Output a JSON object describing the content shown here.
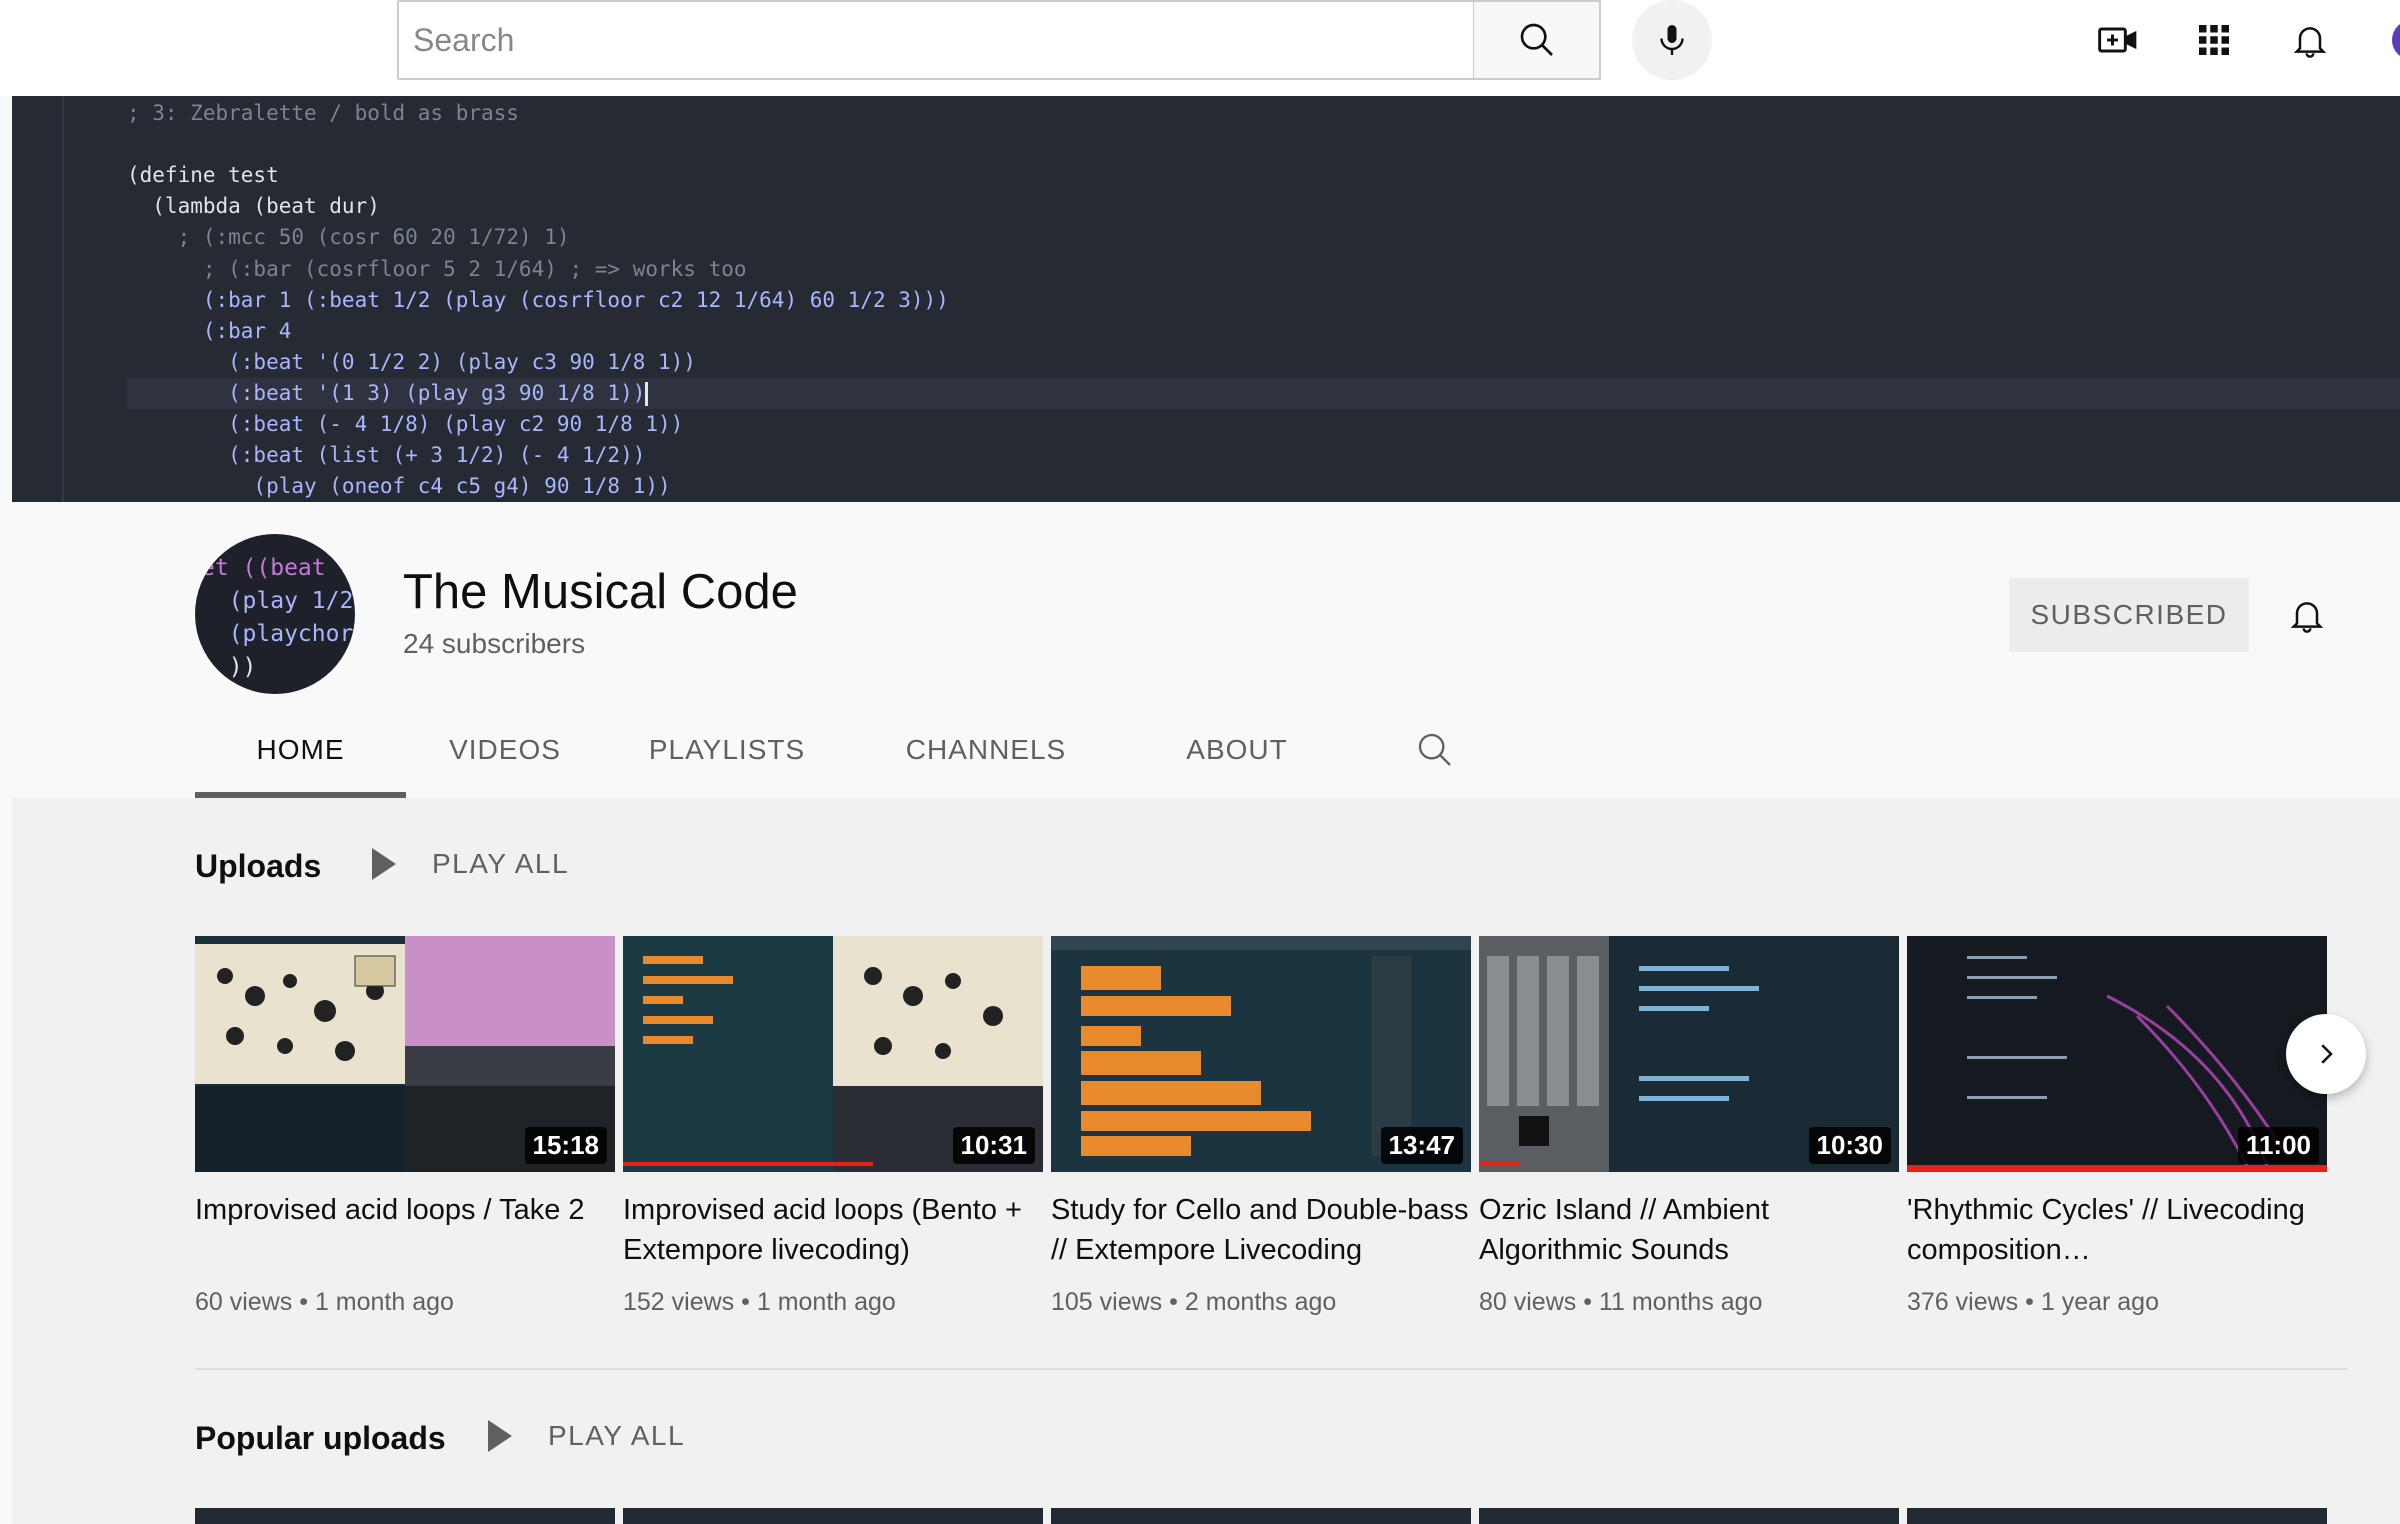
{
  "topbar": {
    "search_placeholder": "Search",
    "icons": [
      "search-icon",
      "mic-icon",
      "create-video-icon",
      "apps-grid-icon",
      "notifications-bell-icon",
      "account-avatar"
    ]
  },
  "banner": {
    "code_lines": [
      "; 3: Zebralette / bold as brass",
      "",
      "(define test",
      "  (lambda (beat dur)",
      "    ; (:mcc 50 (cosr 60 20 1/72) 1)",
      "      ; (:bar (cosrfloor 5 2 1/64) ; => works too",
      "      (:bar 1 (:beat 1/2 (play (cosrfloor c2 12 1/64) 60 1/2 3)))",
      "      (:bar 4",
      "        (:beat '(0 1/2 2) (play c3 90 1/8 1))",
      "        (:beat '(1 3) (play g3 90 1/8 1))",
      "        (:beat (- 4 1/8) (play c2 90 1/8 1))",
      "        (:beat (list (+ 3 1/2) (- 4 1/2))",
      "          (play (oneof c4 c5 g4) 90 1/8 1))"
    ]
  },
  "channel": {
    "avatar_code": [
      "et ((beat",
      "  (play 1/2",
      "  (playchor",
      "  ))"
    ],
    "name": "The Musical Code",
    "subscribers": "24 subscribers",
    "subscribed_label": "SUBSCRIBED",
    "tabs": [
      {
        "label": "HOME",
        "active": true
      },
      {
        "label": "VIDEOS",
        "active": false
      },
      {
        "label": "PLAYLISTS",
        "active": false
      },
      {
        "label": "CHANNELS",
        "active": false
      },
      {
        "label": "ABOUT",
        "active": false
      }
    ]
  },
  "uploads": {
    "title": "Uploads",
    "play_all": "PLAY ALL",
    "videos": [
      {
        "title": "Improvised acid loops / Take 2",
        "duration": "15:18",
        "views": "60 views",
        "age": "1 month ago"
      },
      {
        "title": "Improvised acid loops (Bento + Extempore livecoding)",
        "duration": "10:31",
        "views": "152 views",
        "age": "1 month ago"
      },
      {
        "title": "Study for Cello and Double-bass // Extempore Livecoding",
        "duration": "13:47",
        "views": "105 views",
        "age": "2 months ago"
      },
      {
        "title": "Ozric Island // Ambient Algorithmic Sounds",
        "duration": "10:30",
        "views": "80 views",
        "age": "11 months ago"
      },
      {
        "title": "'Rhythmic Cycles' // Livecoding composition…",
        "duration": "11:00",
        "views": "376 views",
        "age": "1 year ago"
      }
    ],
    "meta_separator": "•"
  },
  "popular": {
    "title": "Popular uploads",
    "play_all": "PLAY ALL"
  },
  "colors": {
    "banner_bg": "#262a33",
    "progress_red": "#e62117",
    "text_secondary": "#606060"
  }
}
